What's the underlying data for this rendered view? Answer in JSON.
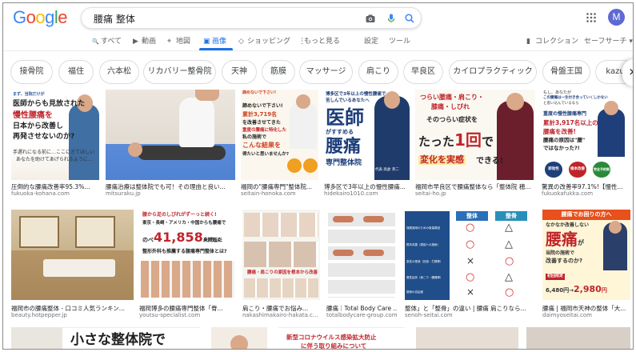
{
  "search": {
    "query": "腰痛 整体"
  },
  "account": {
    "initial": "M"
  },
  "tabs": [
    {
      "label": "すべて",
      "glyph": "🔍"
    },
    {
      "label": "動画",
      "glyph": "▶"
    },
    {
      "label": "地図",
      "glyph": "⌖"
    },
    {
      "label": "画像",
      "glyph": "▣"
    },
    {
      "label": "ショッピング",
      "glyph": "◇"
    },
    {
      "label": "もっと見る",
      "glyph": "⋮"
    },
    {
      "label": "設定",
      "glyph": ""
    },
    {
      "label": "ツール",
      "glyph": ""
    },
    {
      "label": "コレクション",
      "glyph": "▮"
    },
    {
      "label": "セーフサーチ ▾",
      "glyph": ""
    }
  ],
  "chips": [
    "接骨院",
    "福住",
    "六本松",
    "リカバリー整骨院",
    "天神",
    "筋膜",
    "マッサージ",
    "肩こり",
    "早良区",
    "カイロプラクティック",
    "骨盤王国",
    "kazu"
  ],
  "results": [
    {
      "caption": "圧倒的な腰痛改善率95.3%...",
      "source": "fukuoka-kohana.com"
    },
    {
      "caption": "腰痛治療は整体院でも可！その理由と良い...",
      "source": "mitsuraku.jp"
    },
    {
      "caption": "福岡の\"腰痛専門\"整体院...",
      "source": "seitain-honoka.com"
    },
    {
      "caption": "博多区で3年以上の慢性腰痛...",
      "source": "hidekairo1010.com"
    },
    {
      "caption": "福岡市早良区で腰痛整体なら「整体院 穂...",
      "source": "seitai-ho.jp"
    },
    {
      "caption": "驚異の改善率97.1%!【慢性...",
      "source": "fukuokafukka.com"
    },
    {
      "caption": "福岡市の腰痛整体 - 口コミ人気ランキン...",
      "source": "beauty.hotpepper.jp"
    },
    {
      "caption": "福岡博多の腰痛専門整体「脊...",
      "source": "youtsu-specialist.com"
    },
    {
      "caption": "肩こり・腰痛でお悩み...",
      "source": "nakashimakairo-hakata.c..."
    },
    {
      "caption": "腰痛｜Total Body Care ...",
      "source": "totalbodycare-group.com"
    },
    {
      "caption": "整体」と「整骨」の違い | 腰痛 肩こりなら...",
      "source": "senoh-seitai.com"
    },
    {
      "caption": "腰痛 | 福岡市天神の整体「大...",
      "source": "daimyoseitai.com"
    }
  ],
  "overlays": {
    "t1": [
      "まず、当院だけが",
      "医師からも見放された",
      "慢性腰痛を",
      "日本から改善し",
      "再発させないのか?",
      "手遅れになる前に…ここにきてほしい",
      "あなたを助けてあげられるように…"
    ],
    "t3": [
      "諦めないで下さい!",
      "累計3,719名",
      "を改善させてきた",
      "重度の腰痛に特化した",
      "私の施術で",
      "こんな結果を",
      "得たいと思いませんか?",
      "土日祝も営業",
      "夜22時まで営業"
    ],
    "t4": [
      "博多区で3年以上の慢性腰痛で",
      "苦しんでいるあなたへ",
      "医師",
      "がすすめる",
      "腰痛",
      "専門整体院",
      "代表 高倉 英二"
    ],
    "t5": [
      "つらい腰痛・肩こり・",
      "膝痛・しびれ",
      "そのつらい症状を",
      "たった",
      "1回",
      "で",
      "変化を実感",
      "できる!"
    ],
    "t6": [
      "もし、あなたが",
      "この腰痛は一生付き合っていくしかない",
      "と思い込んでいるなら",
      "重度の慢性腰痛専門",
      "累計3,917名以上の",
      "腰痛を改善!",
      "腰痛の原因は\"腰\"",
      "ではなかった?!",
      "即効性",
      "根本改善",
      "完全予約制"
    ],
    "t8": [
      "腰から足のしびれがずーっと続く!",
      "東京・長崎・アメリカ・中国からも腰痛で",
      "のべ",
      "41,858",
      "人が既に",
      "来院した",
      "整形外科も推薦する腰痛専門整体とは?"
    ],
    "t9": [
      "腰痛・肩こりの原因を根本から改善"
    ],
    "t11": [
      "整体",
      "整骨"
    ],
    "t12": [
      "腰痛でお困りの方へ",
      "なかなか改善しない",
      "腰痛",
      "が",
      "当院の施術で",
      "改善するのか?",
      "初回限定",
      "6,480円→",
      "2,980",
      "円"
    ],
    "r3a": [
      "小さな整体院で"
    ],
    "r3b": [
      "新型コロナウイルス感染拡大防止",
      "に伴う取り組みについて"
    ]
  },
  "comparison_rows": [
    {
      "label": "保険適用のための負傷原因",
      "seitai": "○",
      "seikotsu": "△"
    },
    {
      "label": "根本改善（原因への施術）",
      "seitai": "○",
      "seikotsu": "△"
    },
    {
      "label": "急性の怪我（捻挫・打撲等）",
      "seitai": "×",
      "seikotsu": "○"
    },
    {
      "label": "慢性症状（肩こり・腰痛等）",
      "seitai": "○",
      "seikotsu": "△"
    },
    {
      "label": "施術の自由度",
      "seitai": "×",
      "seikotsu": "○"
    }
  ],
  "colors": {
    "accent": "#1a73e8",
    "logo_blue": "#4285f4",
    "logo_red": "#ea4335",
    "logo_yellow": "#fbbc05",
    "logo_green": "#34a853"
  }
}
